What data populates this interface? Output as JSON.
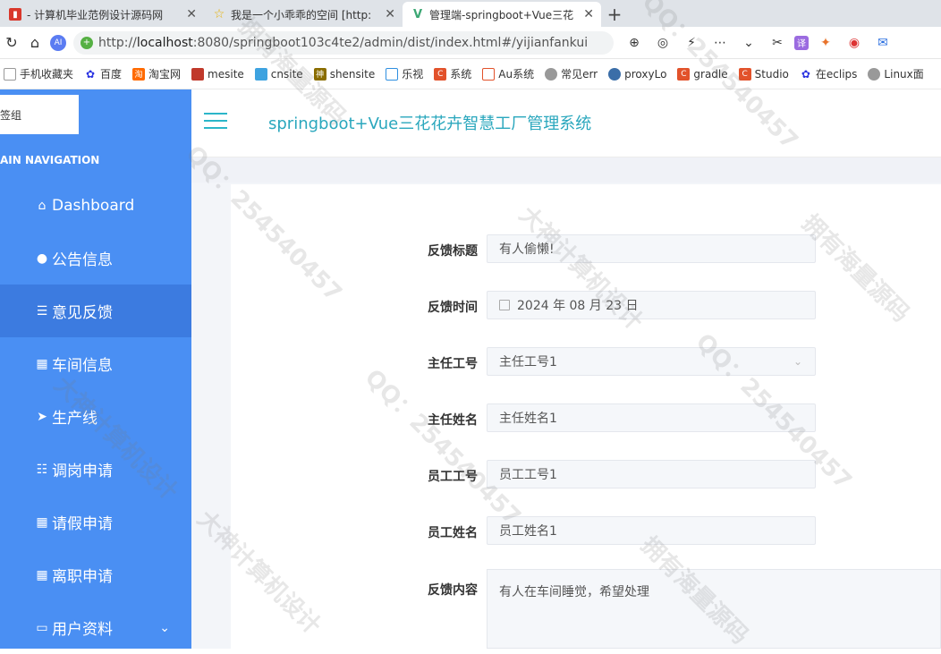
{
  "browser": {
    "tabs": [
      {
        "title": "- 计算机毕业范例设计源码网",
        "icon": "red-flag-icon",
        "active": false
      },
      {
        "title": "我是一个小乖乖的空间 [http:",
        "icon": "star-icon",
        "active": false
      },
      {
        "title": "管理端-springboot+Vue三花",
        "icon": "vue-icon",
        "active": true
      }
    ],
    "new_tab": "+",
    "url_prefix": "http://",
    "url_host": "localhost",
    "url_rest": ":8080/springboot103c4te2/admin/dist/index.html#/yijianfankui",
    "bookmarks": [
      "手机收藏夹",
      "百度",
      "淘宝网",
      "mesite",
      "cnsite",
      "shensite",
      "乐视",
      "系统",
      "Au系统",
      "常见err",
      "proxyLo",
      "gradle",
      "Studio",
      "在eclips",
      "Linux面"
    ]
  },
  "sidebar": {
    "search_text": "签组",
    "heading": "AIN NAVIGATION",
    "items": [
      {
        "label": "Dashboard",
        "icon": "home-icon",
        "active": false
      },
      {
        "label": "公告信息",
        "icon": "bulb-icon",
        "active": false
      },
      {
        "label": "意见反馈",
        "icon": "list-icon",
        "active": true
      },
      {
        "label": "车间信息",
        "icon": "grid-icon",
        "active": false
      },
      {
        "label": "生产线",
        "icon": "send-icon",
        "active": false
      },
      {
        "label": "调岗申请",
        "icon": "sliders-icon",
        "active": false
      },
      {
        "label": "请假申请",
        "icon": "grid-icon",
        "active": false
      },
      {
        "label": "离职申请",
        "icon": "grid-icon",
        "active": false
      },
      {
        "label": "用户资料",
        "icon": "card-icon",
        "active": false
      }
    ]
  },
  "header": {
    "title": "springboot+Vue三花花卉智慧工厂管理系统"
  },
  "form": {
    "title_label": "反馈标题",
    "title_value": "有人偷懒!",
    "time_label": "反馈时间",
    "time_value": "2024 年 08 月 23 日",
    "supervisor_id_label": "主任工号",
    "supervisor_id_value": "主任工号1",
    "supervisor_name_label": "主任姓名",
    "supervisor_name_value": "主任姓名1",
    "employee_id_label": "员工工号",
    "employee_id_value": "员工工号1",
    "employee_name_label": "员工姓名",
    "employee_name_value": "员工姓名1",
    "content_label": "反馈内容",
    "content_value": "有人在车间睡觉，希望处理"
  },
  "watermarks": [
    "QQ：254540457",
    "大神计算机设计",
    "拥有海量源码"
  ]
}
